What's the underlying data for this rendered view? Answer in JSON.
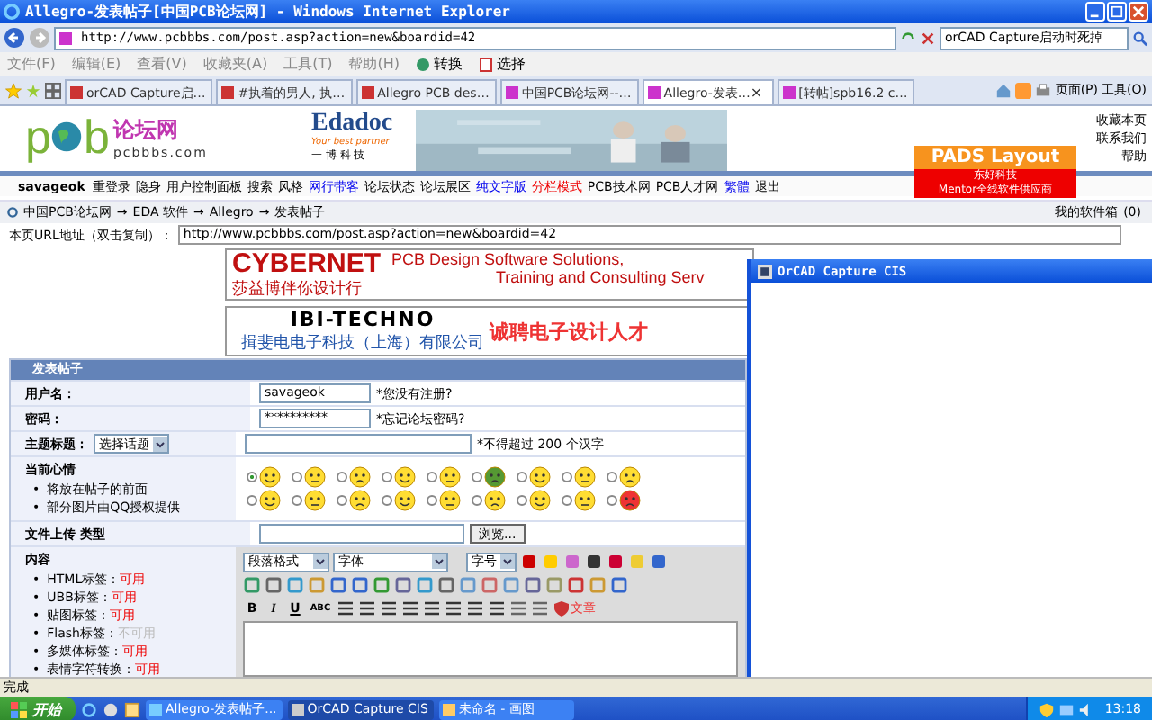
{
  "window": {
    "title": "Allegro-发表帖子[中国PCB论坛网] - Windows Internet Explorer"
  },
  "address_bar": {
    "url": "http://www.pcbbbs.com/post.asp?action=new&boardid=42",
    "search": "orCAD Capture启动时死掉"
  },
  "menu": [
    "文件(F)",
    "编辑(E)",
    "查看(V)",
    "收藏夹(A)",
    "工具(T)",
    "帮助(H)"
  ],
  "toolbar_buttons": [
    "转换",
    "选择"
  ],
  "tabs": [
    {
      "label": "orCAD Capture启…",
      "selected": false
    },
    {
      "label": "#执着的男人, 执…",
      "selected": false
    },
    {
      "label": "Allegro PCB des…",
      "selected": false
    },
    {
      "label": "中国PCB论坛网--…",
      "selected": false
    },
    {
      "label": "Allegro-发表…",
      "selected": true
    },
    {
      "label": "[转帖]spb16.2 c…",
      "selected": false
    }
  ],
  "tab_close": "×",
  "command_bar": [
    "页面(P)",
    "工具(O)"
  ],
  "site": {
    "logo_left": "p",
    "logo_right": "b",
    "logo_title": "论坛网",
    "logo_domain": "pcbbbs.com",
    "banner": {
      "brand": "Edadoc",
      "slogan": "Your best partner",
      "cn": "一 博 科 技"
    },
    "top_links": [
      "收藏本页",
      "联系我们",
      "帮助"
    ],
    "pads_ad": {
      "title": "PADS Layout",
      "line1": "东好科技",
      "line2": "Mentor全线软件供应商"
    }
  },
  "nav": {
    "user": "savageok",
    "items": [
      {
        "label": "重登录",
        "kind": "plain"
      },
      {
        "label": "隐身",
        "kind": "plain"
      },
      {
        "label": "用户控制面板",
        "kind": "plain"
      },
      {
        "label": "搜索",
        "kind": "plain"
      },
      {
        "label": "风格",
        "kind": "plain"
      },
      {
        "label": "网行带客",
        "kind": "blue"
      },
      {
        "label": "论坛状态",
        "kind": "plain"
      },
      {
        "label": "论坛展区",
        "kind": "plain"
      },
      {
        "label": "纯文字版",
        "kind": "blue"
      },
      {
        "label": "分栏模式",
        "kind": "red"
      },
      {
        "label": "PCB技术网",
        "kind": "plain"
      },
      {
        "label": "PCB人才网",
        "kind": "plain"
      },
      {
        "label": "繁體",
        "kind": "blue"
      },
      {
        "label": "退出",
        "kind": "plain"
      }
    ]
  },
  "breadcrumb": {
    "items": [
      "中国PCB论坛网",
      "EDA 软件",
      "Allegro",
      "发表帖子"
    ],
    "separator": "→",
    "softbox": "我的软件箱",
    "softbox_count": "(0)"
  },
  "url_row": {
    "label": "本页URL地址（双击复制）：",
    "value": "http://www.pcbbbs.com/post.asp?action=new&boardid=42"
  },
  "ads": {
    "cybernet": {
      "brand": "CYBERNET",
      "cn": "莎益博伴你设计行",
      "line1": "PCB Design Software Solutions,",
      "line2": "Training and Consulting Serv"
    },
    "ibi": {
      "brand": "IBI-TECHNO",
      "cn": "揖斐电电子科技（上海）有限公司",
      "slogan": "诚聘电子设计人才"
    }
  },
  "form": {
    "title": "发表帖子",
    "username": {
      "label": "用户名：",
      "value": "savageok",
      "hint": "*您没有注册?"
    },
    "password": {
      "label": "密码：",
      "value": "**********",
      "hint": "*忘记论坛密码?"
    },
    "subject": {
      "label": "主题标题：",
      "topic": "选择话题",
      "hint": "*不得超过 200 个汉字"
    },
    "mood": {
      "label": "当前心情",
      "bullet": "•",
      "notes": [
        "将放在帖子的前面",
        "部分图片由QQ授权提供"
      ],
      "faces": [
        {
          "selected": true
        },
        {
          "selected": false
        },
        {
          "selected": false
        },
        {
          "selected": false
        },
        {
          "selected": false
        },
        {
          "selected": false
        },
        {
          "selected": false
        },
        {
          "selected": false
        },
        {
          "selected": false
        },
        {
          "selected": false
        },
        {
          "selected": false
        },
        {
          "selected": false
        },
        {
          "selected": false
        },
        {
          "selected": false
        },
        {
          "selected": false
        },
        {
          "selected": false
        },
        {
          "selected": false
        },
        {
          "selected": false
        }
      ]
    },
    "upload": {
      "label": "文件上传 类型",
      "button": "浏览..."
    },
    "content": {
      "label": "内容",
      "bullet": "•",
      "tags": [
        {
          "label": "HTML标签：",
          "value": "可用",
          "enabled": true
        },
        {
          "label": "UBB标签：",
          "value": "可用",
          "enabled": true
        },
        {
          "label": "贴图标签：",
          "value": "可用",
          "enabled": true
        },
        {
          "label": "Flash标签：",
          "value": "不可用",
          "enabled": false
        },
        {
          "label": "多媒体标签：",
          "value": "可用",
          "enabled": true
        },
        {
          "label": "表情字符转换：",
          "value": "可用",
          "enabled": true
        }
      ],
      "selects": [
        "段落格式",
        "字体",
        "字号"
      ],
      "format_buttons": [
        "B",
        "I",
        "U",
        "ABC"
      ],
      "article": "文章"
    }
  },
  "popup_window": {
    "title": "OrCAD Capture CIS"
  },
  "status_bar": "完成",
  "taskbar": {
    "start": "开始",
    "tasks": [
      {
        "label": "Allegro-发表帖子...",
        "selected": false
      },
      {
        "label": "OrCAD Capture CIS",
        "selected": true
      },
      {
        "label": "未命名 - 画图",
        "selected": false
      }
    ],
    "clock": "13:18"
  }
}
